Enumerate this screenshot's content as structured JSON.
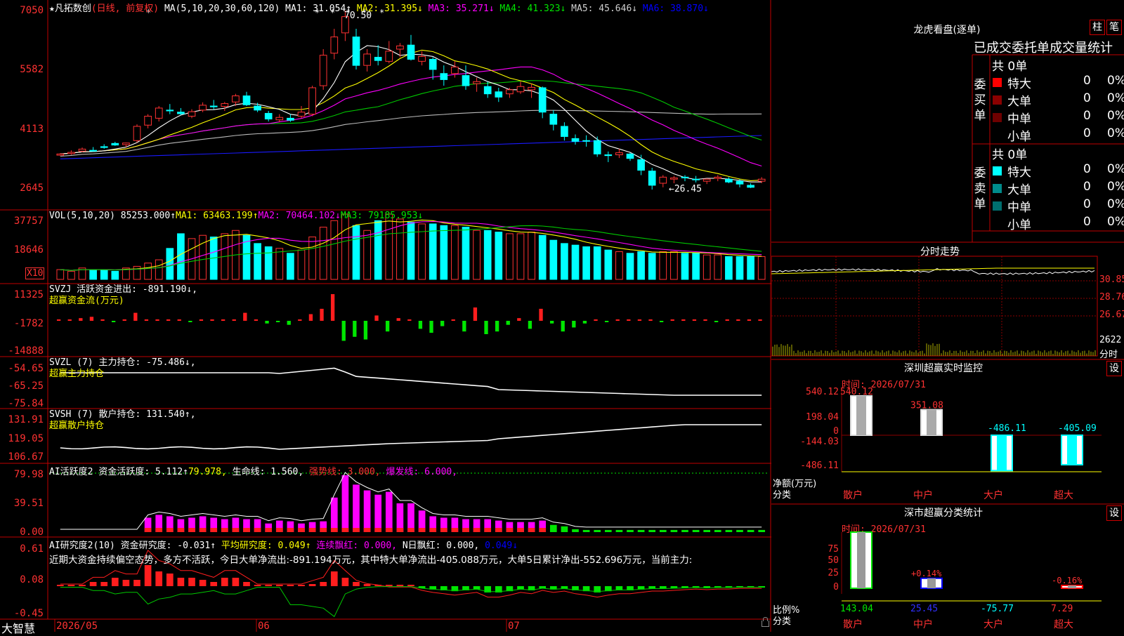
{
  "main_header": {
    "name": "★凡拓数创",
    "mode": "(日线, 前复权)",
    "ma_label": "MA(5,10,20,30,60,120)",
    "ma1": "MA1: 31.054↑",
    "ma2": "MA2: 31.395↓",
    "ma3": "MA3: 35.271↓",
    "ma4": "MA4: 41.323↓",
    "ma5": "MA5: 45.646↓",
    "ma6": "MA6: 38.870↓"
  },
  "price_axis": [
    "7050",
    "5582",
    "4113",
    "2645"
  ],
  "price_annotations": {
    "high": "70.50",
    "low": "←26.45"
  },
  "vol_header": {
    "label": "VOL(5,10,20)",
    "value": "85253.000↑",
    "ma1": "MA1: 63463.199↑",
    "ma2": "MA2: 70464.102↓",
    "ma3": "MA3: 79185.953↓"
  },
  "vol_axis": [
    "37757",
    "18646",
    "X10"
  ],
  "svzj_header": {
    "label": "SVZJ",
    "title": "活跃资金进出: -891.190↓,",
    "subtitle": "超赢资金流(万元)"
  },
  "svzj_axis": [
    "11325",
    "-1782",
    "-14888"
  ],
  "svzl_header": {
    "label": "SVZL (7)",
    "title": "主力持仓: -75.486↓,",
    "subtitle": "超赢主力持仓"
  },
  "svzl_axis": [
    "-54.65",
    "-65.25",
    "-75.84"
  ],
  "svsh_header": {
    "label": "SVSH (7)",
    "title": "散户持仓: 131.540↑,",
    "subtitle": "超赢散户持仓"
  },
  "svsh_axis": [
    "131.91",
    "119.05",
    "106.67"
  ],
  "ai2_header": {
    "label": "AI活跃度2",
    "fund": "资金活跃度: 5.112↑",
    "val2": "79.978,",
    "life": "生命线: 1.560,",
    "strong": "强势线: 3.000,",
    "burst": "爆发线: 6.000,"
  },
  "ai2_axis": [
    "79.98",
    "39.51",
    "0.00"
  ],
  "ai3_header": {
    "label": "AI研究度2(10)",
    "research": "资金研究度: -0.031↑",
    "avg": "平均研究度: 0.049↑",
    "red": "连续飘红: 0.000,",
    "nred": "N日飘红: 0.000,",
    "last": "0.049↓"
  },
  "ai3_text": "近期大资金持续偏空态势，多方不活跃，今日大单净流出:-891.194万元，其中特大单净流出-405.088万元，大单5日累计净出-552.696万元，当前主力:",
  "ai3_axis": [
    "0.61",
    "0.08",
    "-0.45"
  ],
  "date_axis": {
    "corner": "大智慧",
    "d1": "2026/05",
    "d2": "06",
    "d3": "07"
  },
  "lhb": {
    "title": "龙虎看盘(逐单)",
    "btn1": "柱",
    "btn2": "笔",
    "header": "已成交委托单成交量统计",
    "buy_side": "委买单",
    "sell_side": "委卖单",
    "buy_total": "共 0单",
    "sell_total": "共 0单",
    "buy_rows": [
      {
        "name": "特大",
        "count": "0",
        "pct": "0%",
        "color": "#ff0000"
      },
      {
        "name": "大单",
        "count": "0",
        "pct": "0%",
        "color": "#8b0000"
      },
      {
        "name": "中单",
        "count": "0",
        "pct": "0%",
        "color": "#6e0000"
      },
      {
        "name": "小单",
        "count": "0",
        "pct": "0%",
        "color": "#000000"
      }
    ],
    "sell_rows": [
      {
        "name": "特大",
        "count": "0",
        "pct": "0%",
        "color": "#00ffff"
      },
      {
        "name": "大单",
        "count": "0",
        "pct": "0%",
        "color": "#008b8b"
      },
      {
        "name": "中单",
        "count": "0",
        "pct": "0%",
        "color": "#006e6e"
      },
      {
        "name": "小单",
        "count": "0",
        "pct": "0%",
        "color": "#000000"
      }
    ]
  },
  "intraday": {
    "title": "分时走势",
    "axis": [
      "30.85",
      "28.76",
      "26.67",
      "2622"
    ],
    "unit": "分时"
  },
  "sz_monitor": {
    "title": "深圳超赢实时监控",
    "btn": "设",
    "time": "时间: 2026/07/31",
    "axis": [
      "540.12",
      "198.04",
      "0",
      "-144.03",
      "-486.11"
    ],
    "ylabel1": "净额(万元)",
    "ylabel2": "分类",
    "bars": [
      {
        "cat": "散户",
        "value": 540.12,
        "label": "540.12"
      },
      {
        "cat": "中户",
        "value": 351.08,
        "label": "351.08"
      },
      {
        "cat": "大户",
        "value": -486.11,
        "label": "-486.11"
      },
      {
        "cat": "超大",
        "value": -405.09,
        "label": "-405.09"
      }
    ]
  },
  "sz_class": {
    "title": "深市超赢分类统计",
    "btn": "设",
    "time": "时间: 2026/07/31",
    "axis": [
      "75",
      "50",
      "25",
      "0"
    ],
    "ylabel1": "比例%",
    "ylabel2": "分类",
    "bars": [
      {
        "cat": "散户",
        "value": 143.04,
        "label": "143.04",
        "pct": ""
      },
      {
        "cat": "中户",
        "value": 25.45,
        "label": "25.45",
        "pct": "+0.14%"
      },
      {
        "cat": "大户",
        "value": -75.77,
        "label": "-75.77",
        "pct": ""
      },
      {
        "cat": "超大",
        "value": 7.29,
        "label": "7.29",
        "pct": "-0.16%"
      }
    ]
  },
  "chart_data": {
    "type": "candlestick",
    "candles": [
      [
        34.9,
        35.4,
        34.8,
        35.2
      ],
      [
        35.3,
        36.1,
        35.0,
        35.6
      ],
      [
        35.9,
        36.8,
        35.6,
        36.4
      ],
      [
        36.1,
        36.9,
        35.8,
        35.9
      ],
      [
        37.0,
        37.6,
        36.5,
        36.8
      ],
      [
        37.8,
        38.2,
        37.2,
        37.4
      ],
      [
        37.5,
        38.0,
        36.9,
        37.9
      ],
      [
        38.5,
        42.5,
        38.0,
        42.0
      ],
      [
        42.3,
        45.0,
        41.5,
        44.5
      ],
      [
        44.0,
        47.0,
        43.2,
        46.5
      ],
      [
        46.0,
        47.5,
        45.0,
        45.8
      ],
      [
        45.5,
        46.5,
        44.8,
        45.1
      ],
      [
        44.5,
        46.2,
        44.0,
        45.6
      ],
      [
        46.0,
        47.9,
        45.5,
        47.2
      ],
      [
        47.0,
        48.5,
        46.2,
        46.8
      ],
      [
        46.9,
        48.0,
        45.8,
        47.6
      ],
      [
        48.0,
        50.0,
        47.0,
        49.5
      ],
      [
        49.5,
        50.5,
        47.0,
        47.3
      ],
      [
        47.0,
        47.8,
        45.5,
        46.0
      ],
      [
        45.2,
        45.8,
        43.2,
        43.8
      ],
      [
        43.6,
        45.0,
        43.0,
        44.2
      ],
      [
        44.0,
        45.0,
        43.1,
        43.5
      ],
      [
        44.5,
        47.0,
        44.0,
        45.5
      ],
      [
        45.0,
        52.0,
        44.5,
        51.5
      ],
      [
        52.0,
        61.0,
        51.0,
        59.5
      ],
      [
        60.0,
        66.0,
        58.5,
        64.0
      ],
      [
        65.0,
        70.5,
        63.0,
        69.0
      ],
      [
        64.0,
        66.0,
        56.0,
        57.0
      ],
      [
        57.0,
        61.0,
        55.5,
        59.8
      ],
      [
        59.0,
        62.0,
        57.0,
        58.2
      ],
      [
        58.0,
        63.0,
        57.5,
        60.5
      ],
      [
        61.0,
        62.5,
        59.0,
        61.8
      ],
      [
        62.0,
        64.5,
        58.2,
        58.5
      ],
      [
        58.0,
        60.5,
        57.0,
        59.2
      ],
      [
        58.5,
        59.0,
        53.5,
        56.0
      ],
      [
        55.0,
        57.0,
        52.0,
        53.5
      ],
      [
        55.0,
        58.0,
        54.0,
        56.6
      ],
      [
        54.5,
        57.0,
        51.0,
        52.0
      ],
      [
        52.5,
        54.0,
        50.5,
        53.0
      ],
      [
        51.8,
        53.0,
        49.0,
        50.0
      ],
      [
        50.5,
        51.5,
        48.0,
        49.2
      ],
      [
        50.0,
        51.5,
        49.0,
        51.0
      ],
      [
        50.5,
        53.0,
        50.0,
        51.8
      ],
      [
        51.0,
        52.5,
        49.0,
        51.6
      ],
      [
        51.5,
        51.8,
        44.0,
        45.5
      ],
      [
        45.0,
        46.0,
        41.0,
        42.5
      ],
      [
        42.0,
        43.0,
        38.5,
        39.5
      ],
      [
        39.0,
        40.0,
        37.5,
        38.3
      ],
      [
        38.5,
        39.8,
        37.0,
        38.4
      ],
      [
        38.5,
        39.5,
        34.5,
        35.2
      ],
      [
        35.0,
        35.8,
        33.2,
        34.8
      ],
      [
        35.0,
        36.5,
        34.2,
        35.5
      ],
      [
        35.2,
        35.5,
        33.5,
        34.1
      ],
      [
        33.8,
        35.0,
        30.0,
        31.2
      ],
      [
        31.0,
        31.8,
        26.45,
        27.5
      ],
      [
        28.0,
        30.0,
        27.0,
        29.5
      ],
      [
        29.0,
        29.8,
        28.0,
        29.3
      ],
      [
        29.5,
        30.0,
        28.5,
        29.4
      ],
      [
        29.0,
        29.8,
        28.2,
        28.9
      ],
      [
        28.5,
        29.2,
        27.8,
        29.0
      ],
      [
        29.2,
        30.0,
        28.5,
        29.5
      ],
      [
        29.0,
        29.5,
        28.0,
        28.3
      ],
      [
        28.5,
        29.0,
        27.0,
        27.8
      ],
      [
        27.5,
        28.0,
        26.8,
        27.0
      ],
      [
        28.5,
        29.5,
        28.0,
        29.0
      ]
    ],
    "volume": [
      6,
      5,
      7,
      6,
      6,
      5,
      7,
      8,
      10,
      12,
      19,
      28,
      25,
      27,
      26,
      28,
      30,
      27,
      22,
      20,
      19,
      16,
      18,
      26,
      32,
      36,
      40,
      33,
      30,
      36,
      40,
      37,
      35,
      34,
      34,
      33,
      33,
      32,
      30,
      30,
      29,
      28,
      28,
      29,
      27,
      24,
      22,
      21,
      20,
      20,
      18,
      17,
      16,
      17,
      16,
      17,
      17,
      16,
      16,
      15,
      15,
      14,
      14,
      14,
      14
    ],
    "svzj": [
      0,
      0,
      2,
      3,
      0,
      -1,
      0,
      6,
      1,
      0,
      1,
      0,
      -1,
      1,
      0,
      1,
      0,
      6,
      0,
      -2,
      -1,
      -3,
      0,
      5,
      9,
      20,
      -15,
      -12,
      -14,
      4,
      -8,
      2,
      0,
      -6,
      -9,
      -4,
      1,
      -8,
      10,
      -10,
      -8,
      -3,
      2,
      -6,
      9,
      -2,
      -8,
      -5,
      -2,
      0,
      -1,
      0,
      0,
      1,
      0,
      -1,
      0,
      0,
      0,
      0,
      -1,
      0,
      0,
      0,
      0
    ],
    "ai2": [
      0,
      0,
      0,
      0,
      0,
      0,
      0,
      0,
      20,
      24,
      22,
      18,
      20,
      22,
      20,
      18,
      20,
      18,
      18,
      12,
      16,
      15,
      12,
      14,
      15,
      48,
      79,
      66,
      58,
      52,
      56,
      40,
      40,
      30,
      22,
      20,
      20,
      18,
      18,
      18,
      16,
      14,
      14,
      14,
      16,
      10,
      8,
      4,
      3,
      3,
      3,
      3,
      3,
      3,
      3,
      3,
      3,
      3,
      3,
      3,
      3,
      3,
      3,
      3,
      3
    ],
    "ai3": [
      0,
      0,
      0,
      0.1,
      0.1,
      0.2,
      0.15,
      0.15,
      0.5,
      0.35,
      0.3,
      0.2,
      0.2,
      0.15,
      0.1,
      0.2,
      0.2,
      0.1,
      0,
      0,
      0,
      0,
      0,
      0.05,
      0.1,
      0.35,
      0.2,
      0.1,
      0.05,
      0.03,
      0,
      0,
      0,
      -0.05,
      -0.08,
      -0.1,
      -0.12,
      -0.1,
      -0.08,
      -0.15,
      -0.15,
      -0.12,
      -0.08,
      -0.1,
      -0.05,
      -0.08,
      -0.06,
      -0.1,
      -0.12,
      -0.15,
      -0.12,
      -0.1,
      -0.1,
      -0.08,
      -0.06,
      -0.06,
      -0.05,
      -0.04,
      -0.03,
      -0.04,
      -0.03,
      -0.03,
      -0.02,
      -0.02,
      -0.02
    ]
  }
}
